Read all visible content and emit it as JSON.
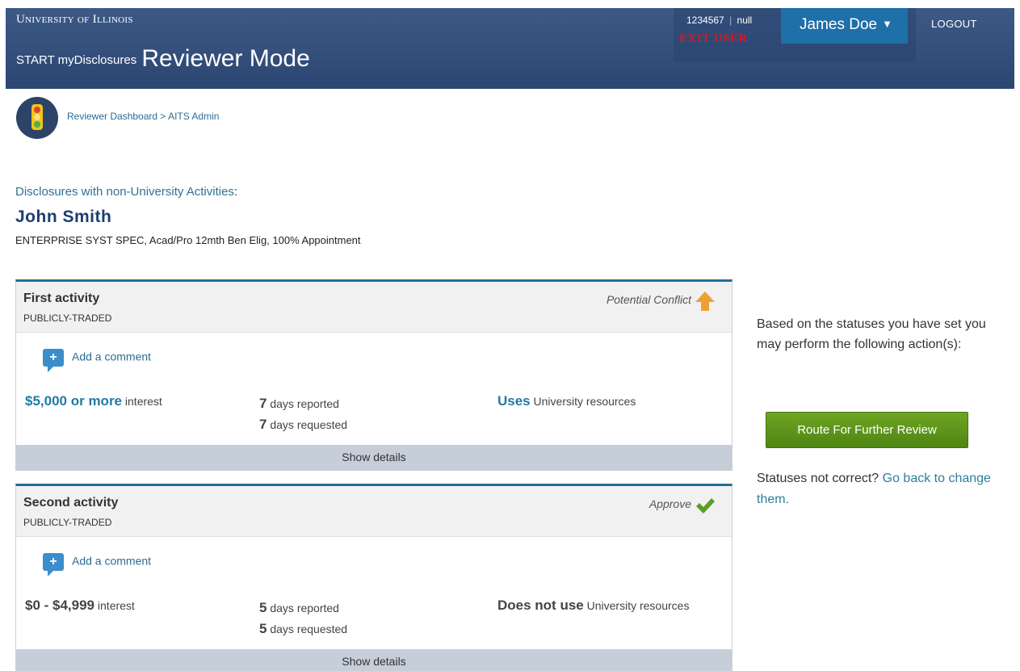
{
  "header": {
    "university": "University of Illinois",
    "app_prefix": "START myDisclosures",
    "app_mode": "Reviewer Mode",
    "uin": "1234567",
    "separator": "|",
    "uin_suffix": "null",
    "exit_user": "EXIT USER",
    "user_name": "James Doe",
    "logout": "LOGOUT"
  },
  "breadcrumb": {
    "icon": "traffic-light-icon",
    "dashboard": "Reviewer Dashboard",
    "separator": ">",
    "current": "AITS Admin"
  },
  "section": {
    "label": "Disclosures with non-University Activities",
    "colon": ":",
    "person_name": "John Smith",
    "person_title": "ENTERPRISE SYST SPEC, Acad/Pro 12mth Ben Elig, 100% Appointment"
  },
  "activities": [
    {
      "title": "First activity",
      "type": "PUBLICLY-TRADED",
      "status": "Potential Conflict",
      "status_icon": "arrow-up-icon",
      "status_color": "#f0a030",
      "comment_label": "Add a comment",
      "interest_value": "$5,000 or more",
      "interest_suffix": "interest",
      "days_reported_num": "7",
      "days_reported_label": "days reported",
      "days_requested_num": "7",
      "days_requested_label": "days requested",
      "resources_value": "Uses",
      "resources_suffix": "University resources",
      "show_details": "Show details"
    },
    {
      "title": "Second activity",
      "type": "PUBLICLY-TRADED",
      "status": "Approve",
      "status_icon": "checkmark-icon",
      "status_color": "#58a020",
      "comment_label": "Add a comment",
      "interest_value": "$0 - $4,999",
      "interest_suffix": "interest",
      "days_reported_num": "5",
      "days_reported_label": "days reported",
      "days_requested_num": "5",
      "days_requested_label": "days requested",
      "resources_value": "Does not use",
      "resources_suffix": "University resources",
      "show_details": "Show details"
    }
  ],
  "side_panel": {
    "info": "Based on the statuses you have set you may perform the following action(s):",
    "route_button": "Route For Further Review",
    "statuses_question": "Statuses not correct?",
    "go_back_link": "Go back to change them."
  }
}
